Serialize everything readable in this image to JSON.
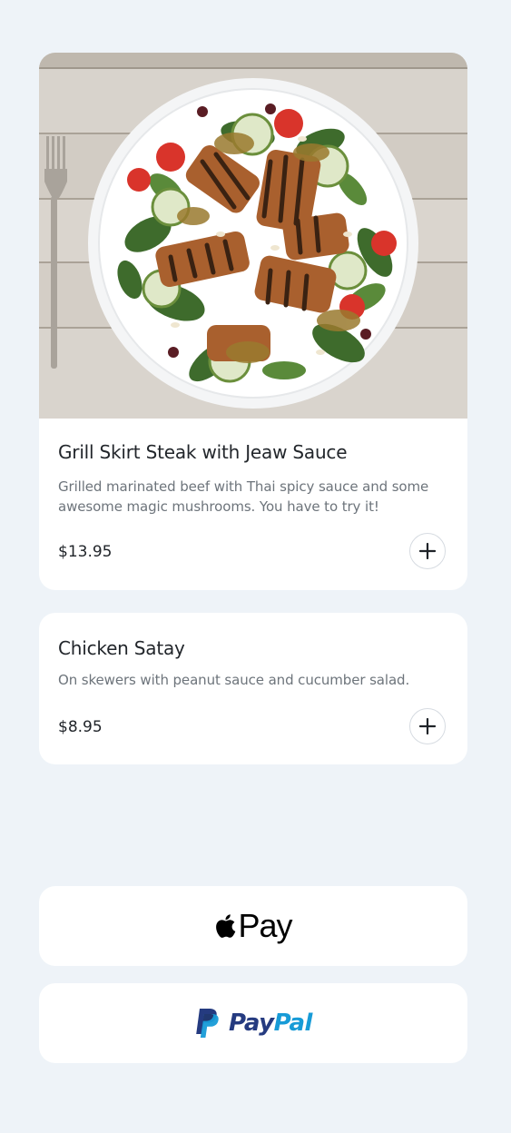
{
  "menu": {
    "items": [
      {
        "title": "Grill Skirt Steak with Jeaw Sauce",
        "description": "Grilled marinated beef with Thai spicy sauce and some awesome magic mushrooms. You have to try it!",
        "price": "$13.95",
        "image_icon": "salad-plate-photo",
        "add_icon": "plus-icon"
      },
      {
        "title": "Chicken Satay",
        "description": "On skewers with peanut sauce and cucumber salad.",
        "price": "$8.95",
        "add_icon": "plus-icon"
      }
    ]
  },
  "payment": {
    "apple_pay_label": "Pay",
    "apple_icon": "apple-logo-icon",
    "paypal_label_1": "Pay",
    "paypal_label_2": "Pal",
    "paypal_icon": "paypal-p-logo-icon"
  },
  "colors": {
    "background": "#eef3f8",
    "card": "#ffffff",
    "paypal_dark": "#253b80",
    "paypal_light": "#179bd7"
  }
}
